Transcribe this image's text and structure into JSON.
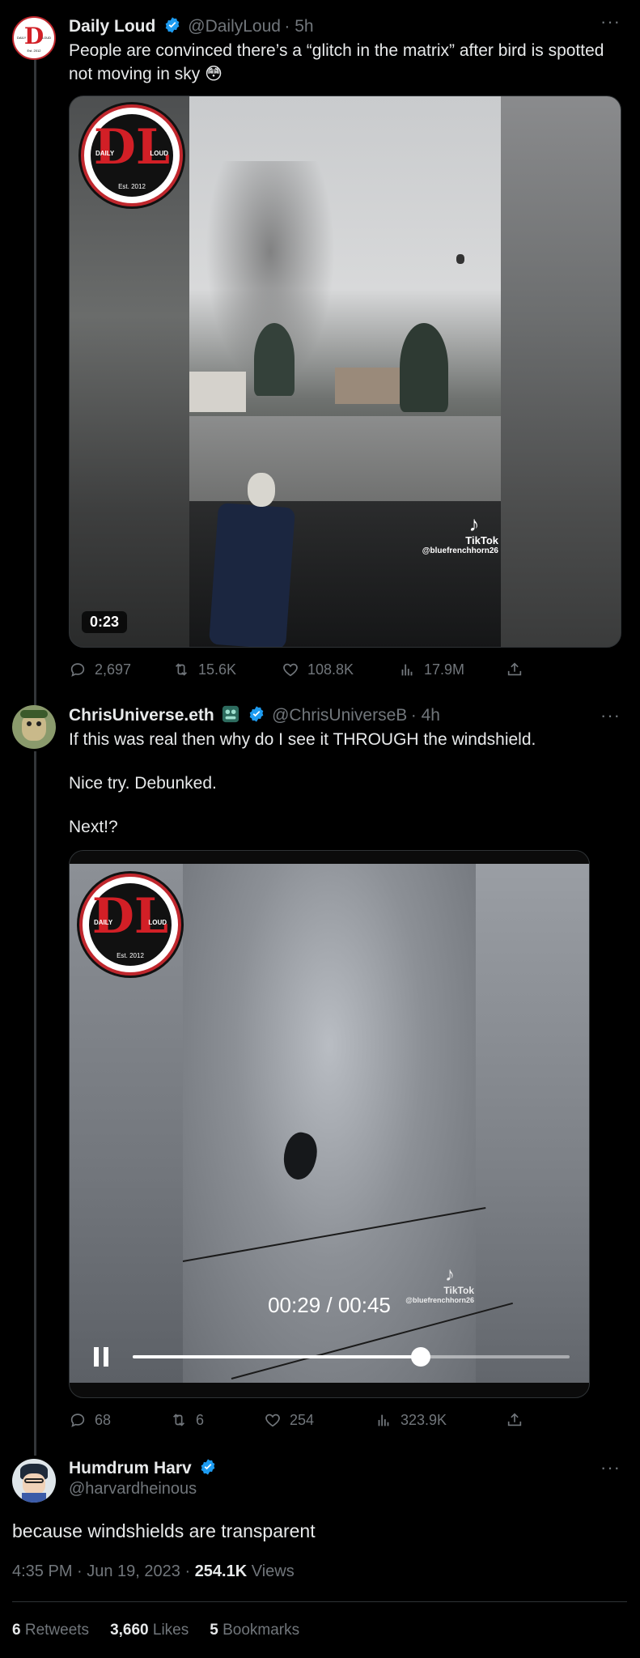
{
  "tweet1": {
    "name": "Daily Loud",
    "handle": "@DailyLoud",
    "time": "· 5h",
    "text": "People are convinced there’s a “glitch in the matrix” after bird is spotted not moving in sky 😳",
    "avatar_lines": {
      "a": "DAILY",
      "b": "LOUD",
      "c": "Est. 2012"
    },
    "media": {
      "duration": "0:23",
      "logo_letters": "DL",
      "logo_left": "DAILY",
      "logo_right": "LOUD",
      "logo_est": "Est. 2012",
      "watermark_brand": "TikTok",
      "watermark_user": "@bluefrenchhorn26"
    },
    "actions": {
      "replies": "2,697",
      "retweets": "15.6K",
      "likes": "108.8K",
      "views": "17.9M"
    }
  },
  "tweet2": {
    "name": "ChrisUniverse.eth",
    "handle": "@ChrisUniverseB",
    "time": "· 4h",
    "text_line1": "If this was real then why do I see it THROUGH the windshield.",
    "text_line2": "Nice try. Debunked.",
    "text_line3": "Next!?",
    "media": {
      "logo_letters": "DL",
      "logo_left": "DAILY",
      "logo_right": "LOUD",
      "logo_est": "Est. 2012",
      "watermark_brand": "TikTok",
      "watermark_user": "@bluefrenchhorn26",
      "time_display": "00:29 / 00:45",
      "progress": 0.66
    },
    "actions": {
      "replies": "68",
      "retweets": "6",
      "likes": "254",
      "views": "323.9K"
    }
  },
  "tweet3": {
    "name": "Humdrum Harv",
    "handle": "@harvardheinous",
    "text": "because windshields are transparent",
    "timestamp": "4:35 PM · Jun 19, 2023 · ",
    "views_count": "254.1K",
    "views_label": " Views",
    "stats": {
      "retweets_count": "6",
      "retweets_label": "Retweets",
      "likes_count": "3,660",
      "likes_label": "Likes",
      "bookmarks_count": "5",
      "bookmarks_label": "Bookmarks"
    }
  },
  "colors": {
    "accent_blue": "#1d9bf0",
    "muted": "#71767b",
    "text": "#e7e9ea",
    "divider": "#2f3336"
  },
  "icons": [
    "verified-badge-icon",
    "more-icon",
    "reply-icon",
    "retweet-icon",
    "like-icon",
    "views-icon",
    "share-icon",
    "pause-icon",
    "tiktok-icon",
    "nft-badge-icon"
  ]
}
